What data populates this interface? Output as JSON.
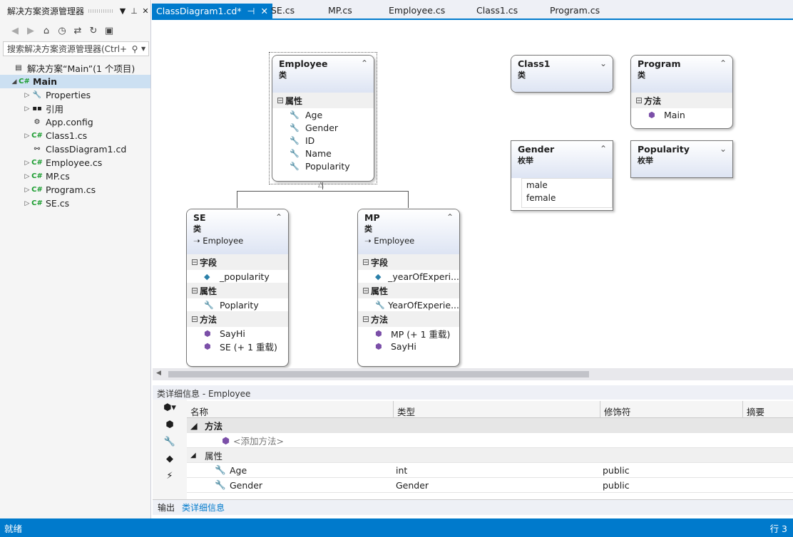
{
  "solution_explorer": {
    "title": "解决方案资源管理器",
    "search_placeholder": "搜索解决方案资源管理器(Ctrl+",
    "solution_label": "解决方案“Main”(1 个项目)",
    "project": "Main",
    "items": [
      {
        "label": "Properties",
        "icon": "wrench-icon"
      },
      {
        "label": "引用",
        "icon": "references-icon"
      },
      {
        "label": "App.config",
        "icon": "config-file-icon"
      },
      {
        "label": "Class1.cs",
        "icon": "csharp-file-icon"
      },
      {
        "label": "ClassDiagram1.cd",
        "icon": "class-diagram-icon"
      },
      {
        "label": "Employee.cs",
        "icon": "csharp-file-icon"
      },
      {
        "label": "MP.cs",
        "icon": "csharp-file-icon"
      },
      {
        "label": "Program.cs",
        "icon": "csharp-file-icon"
      },
      {
        "label": "SE.cs",
        "icon": "csharp-file-icon"
      }
    ]
  },
  "tabs": [
    "ClassDiagram1.cd*",
    "SE.cs",
    "MP.cs",
    "Employee.cs",
    "Class1.cs",
    "Program.cs"
  ],
  "diagram": {
    "employee": {
      "name": "Employee",
      "kind": "类",
      "section": "属性",
      "members": [
        "Age",
        "Gender",
        "ID",
        "Name",
        "Popularity"
      ]
    },
    "se": {
      "name": "SE",
      "kind": "类",
      "base": "Employee",
      "fields_label": "字段",
      "field": "_popularity",
      "props_label": "属性",
      "prop": "Poplarity",
      "methods_label": "方法",
      "methods": [
        "SayHi",
        "SE (+ 1 重载)"
      ]
    },
    "mp": {
      "name": "MP",
      "kind": "类",
      "base": "Employee",
      "fields_label": "字段",
      "field": "_yearOfExperi...",
      "props_label": "属性",
      "prop": "YearOfExperie...",
      "methods_label": "方法",
      "methods": [
        "MP (+ 1 重载)",
        "SayHi"
      ]
    },
    "class1": {
      "name": "Class1",
      "kind": "类"
    },
    "program": {
      "name": "Program",
      "kind": "类",
      "methods_label": "方法",
      "method": "Main"
    },
    "gender": {
      "name": "Gender",
      "kind": "枚举",
      "values": [
        "male",
        "female"
      ]
    },
    "popularity": {
      "name": "Popularity",
      "kind": "枚举"
    }
  },
  "class_details": {
    "title": "类详细信息 - Employee",
    "columns": [
      "名称",
      "类型",
      "修饰符",
      "摘要"
    ],
    "methods_group": "方法",
    "add_method": "<添加方法>",
    "props_group": "属性",
    "rows": [
      {
        "name": "Age",
        "type": "int",
        "modifier": "public"
      },
      {
        "name": "Gender",
        "type": "Gender",
        "modifier": "public"
      }
    ]
  },
  "bottom_tabs": [
    "输出",
    "类详细信息"
  ],
  "status": {
    "left": "就绪",
    "right": "行 3"
  },
  "colors": {
    "accent": "#007acc"
  }
}
